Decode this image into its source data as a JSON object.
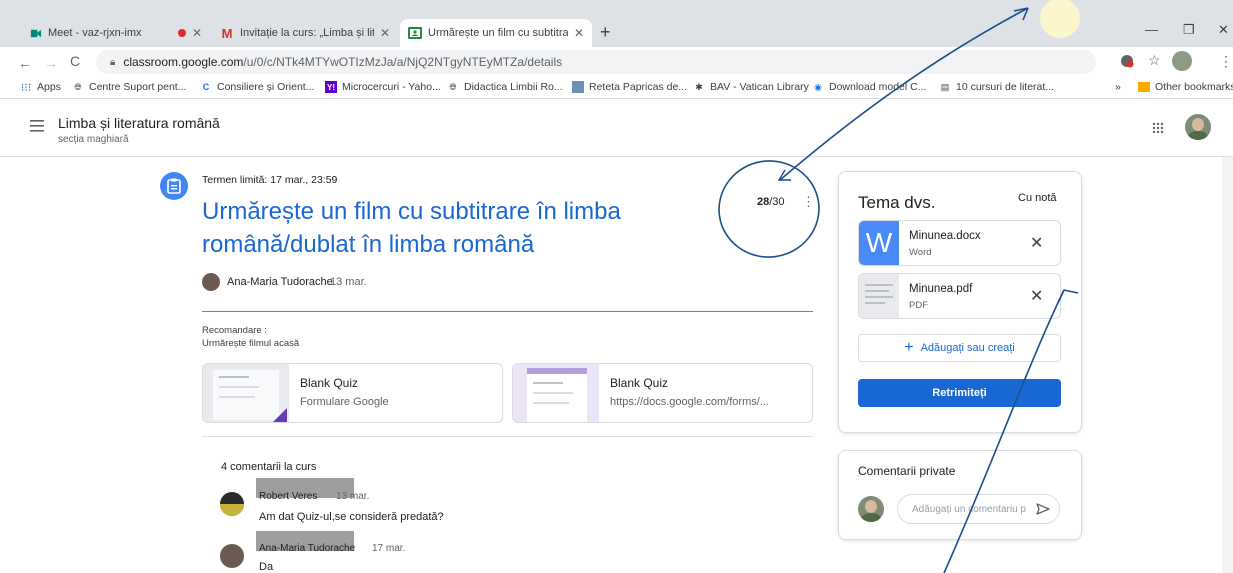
{
  "browser": {
    "tabs": [
      {
        "title": "Meet - vaz-rjxn-imx",
        "recording": true
      },
      {
        "title": "Invitație la curs: „Limba și literatu",
        "icon": "gmail-icon"
      },
      {
        "title": "Urmărește un film cu subtitrare în",
        "icon": "classroom-icon",
        "active": true
      }
    ],
    "new_tab": "+",
    "url_host": "classroom.google.com",
    "url_path": "/u/0/c/NTk4MTYwOTIzMzJa/a/NjQ2NTgyNTEyMTZa/details",
    "bookmarks": [
      "Apps",
      "Centre Suport pent...",
      "Consiliere și Orient...",
      "Microcercuri - Yaho...",
      "Didactica Limbii Ro...",
      "Reteta Papricas de...",
      "BAV - Vatican Library",
      "Download model C...",
      "10 cursuri de literat..."
    ],
    "more_bookmarks": "»",
    "other_bookmarks": "Other bookmarks"
  },
  "class": {
    "name": "Limba și literatura română",
    "section": "secția maghiară"
  },
  "assignment": {
    "due": "Termen limită: 17 mar., 23:59",
    "title_line1": "Urmărește un film cu subtitrare în limba",
    "title_line2": "română/dublat în limba română",
    "author": "Ana-Maria Tudorache",
    "date": "13 mar.",
    "grade": "28",
    "grade_total": "/30",
    "instructions_label": "Recomandare :",
    "instructions_text": "Urmărește filmul acasă",
    "attachments": [
      {
        "title": "Blank Quiz",
        "subtitle": "Formulare Google"
      },
      {
        "title": "Blank Quiz",
        "subtitle": "https://docs.google.com/forms/..."
      }
    ]
  },
  "comments": {
    "header": "4 comentarii la curs",
    "items": [
      {
        "author": "Robert Veres",
        "date": "13 mar.",
        "text": "Am dat Quiz-ul,se consideră predată?"
      },
      {
        "author": "Ana-Maria Tudorache",
        "date": "17 mar.",
        "text": "Da"
      }
    ]
  },
  "your_work": {
    "title": "Tema dvs.",
    "status": "Cu notă",
    "files": [
      {
        "name": "Minunea.docx",
        "type": "Word",
        "icon_letter": "W"
      },
      {
        "name": "Minunea.pdf",
        "type": "PDF"
      }
    ],
    "add_button": "Adăugați sau creați",
    "resubmit_button": "Retrimiteți"
  },
  "private_comments": {
    "title": "Comentarii private",
    "placeholder": "Adăugați un comentariu p"
  },
  "colors": {
    "accent": "#1967d2",
    "accent_button": "#1a73e8",
    "ink": "#1a4f8b"
  }
}
